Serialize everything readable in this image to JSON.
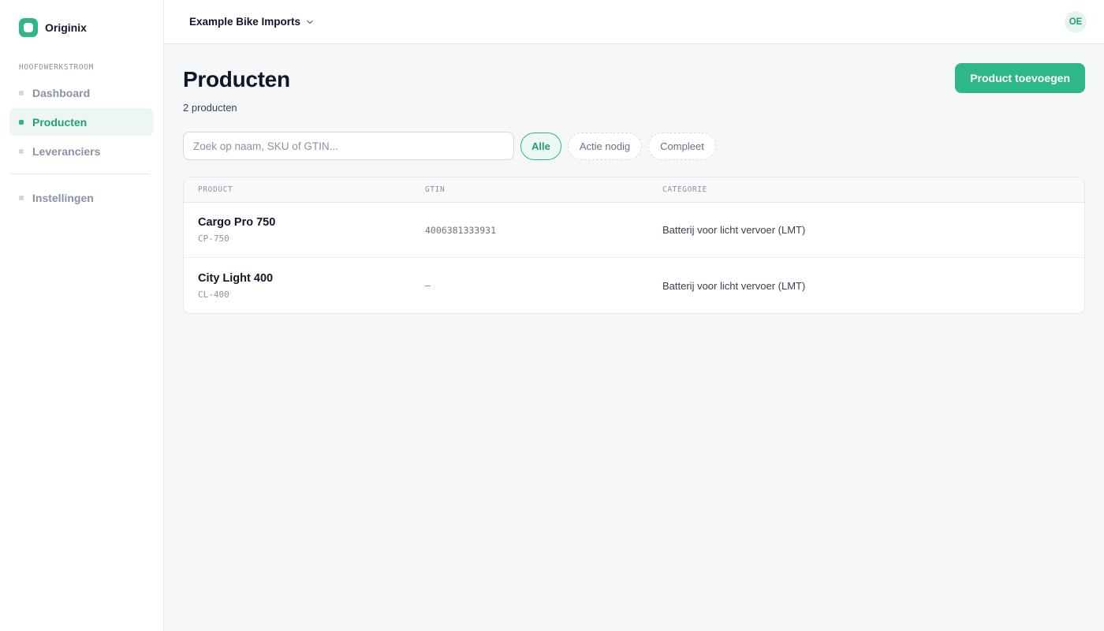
{
  "brand": {
    "name": "Originix"
  },
  "sidebar": {
    "section_label": "HOOFDWERKSTROOM",
    "items": [
      {
        "label": "Dashboard"
      },
      {
        "label": "Producten"
      },
      {
        "label": "Leveranciers"
      }
    ],
    "bottom_items": [
      {
        "label": "Instellingen"
      }
    ]
  },
  "topbar": {
    "org_name": "Example Bike Imports",
    "avatar_initials": "OE"
  },
  "page": {
    "title": "Producten",
    "count": "2 producten",
    "add_button": "Product toevoegen"
  },
  "filters": {
    "search_placeholder": "Zoek op naam, SKU of GTIN...",
    "chips": [
      {
        "label": "Alle",
        "active": true
      },
      {
        "label": "Actie nodig",
        "active": false
      },
      {
        "label": "Compleet",
        "active": false
      }
    ]
  },
  "table": {
    "headers": {
      "product": "PRODUCT",
      "gtin": "GTIN",
      "category": "CATEGORIE"
    },
    "rows": [
      {
        "name": "Cargo Pro 750",
        "sku": "CP-750",
        "gtin": "4006381333931",
        "category": "Batterij voor licht vervoer (LMT)"
      },
      {
        "name": "City Light 400",
        "sku": "CL-400",
        "gtin": "–",
        "category": "Batterij voor licht vervoer (LMT)"
      }
    ]
  },
  "colors": {
    "accent": "#2eb887",
    "accent_text": "#20a371",
    "active_nav_bg": "#eef6f2",
    "background": "#f6f7f9"
  }
}
